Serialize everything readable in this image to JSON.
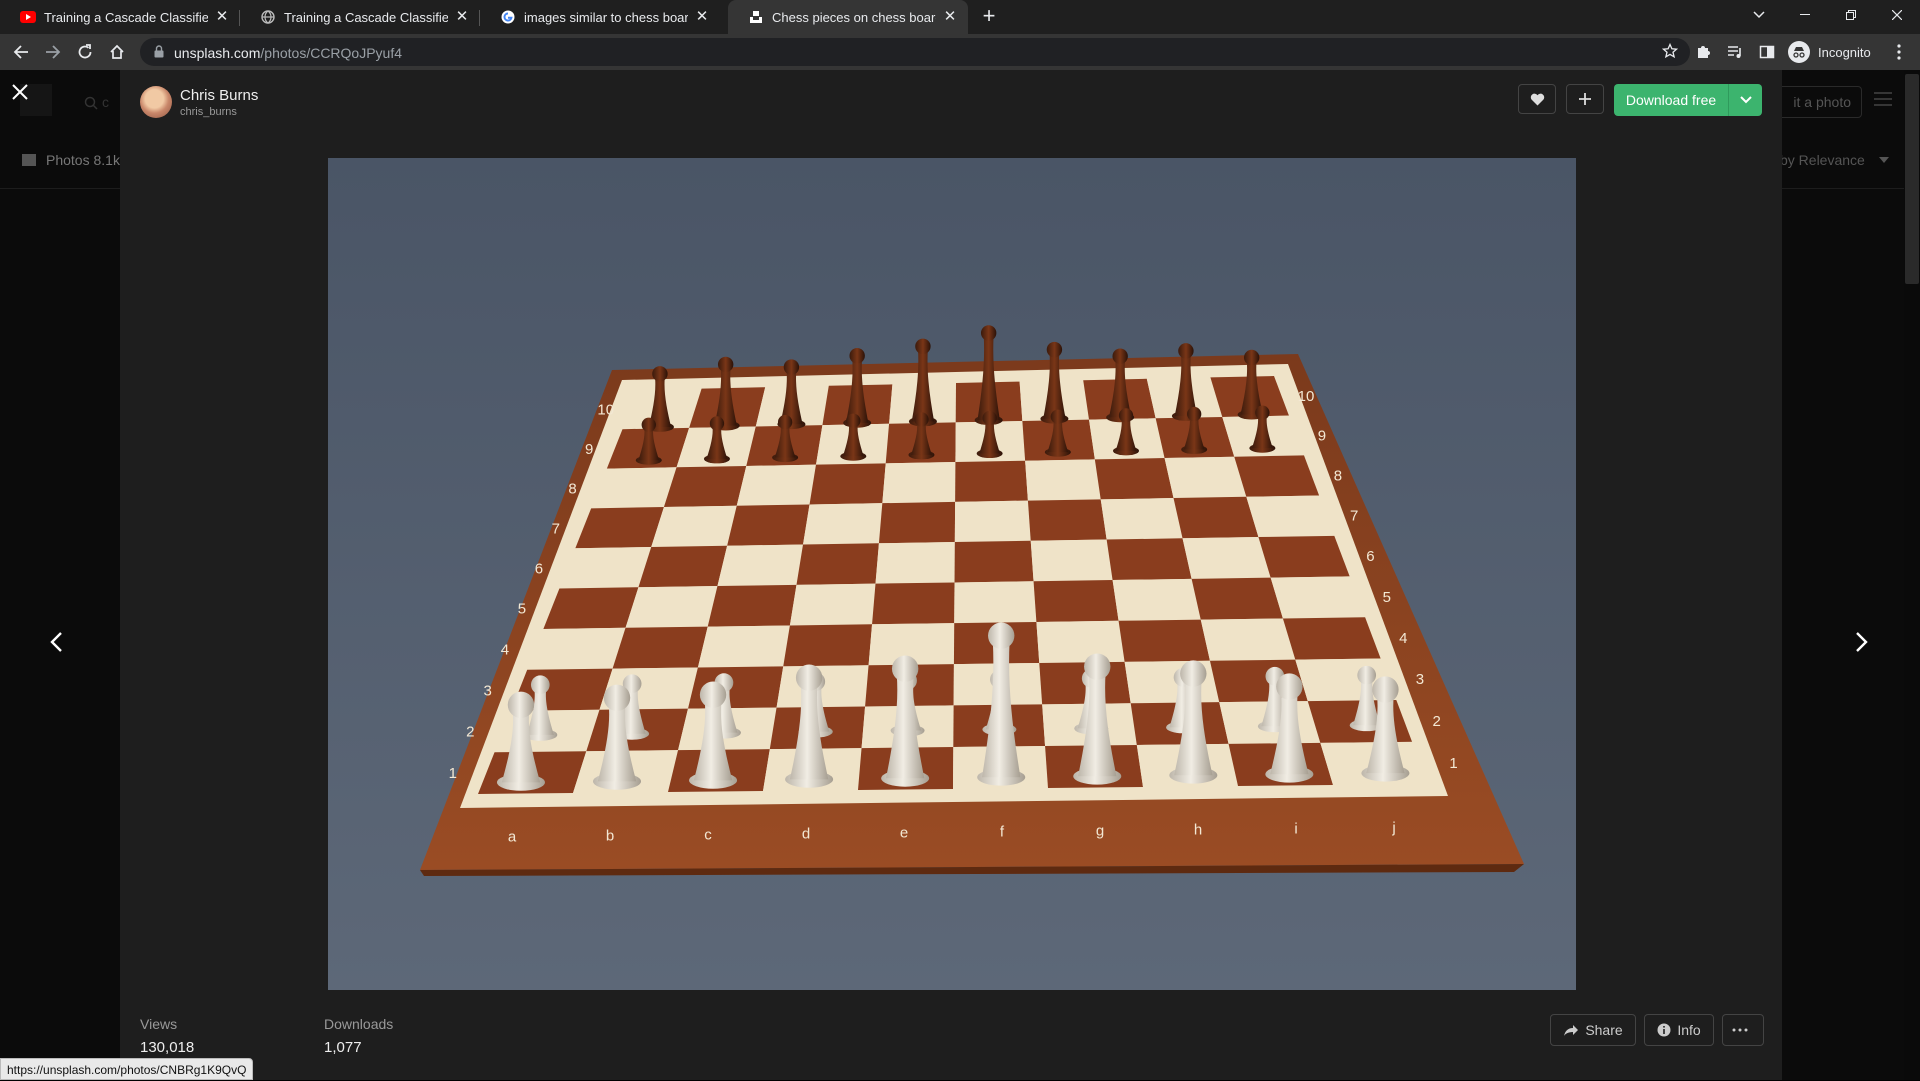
{
  "browser": {
    "tabs": [
      {
        "title": "Training a Cascade Classifier - Op",
        "favicon": "youtube-icon",
        "active": false
      },
      {
        "title": "Training a Cascade Classifier - Le",
        "favicon": "globe-icon",
        "active": false
      },
      {
        "title": "images similar to chess board - G",
        "favicon": "google-icon",
        "active": false
      },
      {
        "title": "Chess pieces on chess board pho",
        "favicon": "unsplash-icon",
        "active": true
      }
    ],
    "url_host": "unsplash.com",
    "url_path": "/photos/CCRQoJPyuf4",
    "profile_label": "Incognito"
  },
  "background_page": {
    "search_placeholder": "c",
    "submit_label": "it a photo",
    "photos_tab": "Photos 8.1k",
    "sort_label": "by Relevance"
  },
  "modal": {
    "author": {
      "name": "Chris Burns",
      "handle": "chris_burns"
    },
    "download_label": "Download free",
    "stats": [
      {
        "label": "Views",
        "value": "130,018"
      },
      {
        "label": "Downloads",
        "value": "1,077"
      }
    ],
    "share_label": "Share",
    "info_label": "Info"
  },
  "photo": {
    "rank_labels": [
      "1",
      "2",
      "3",
      "4",
      "5",
      "6",
      "7",
      "8",
      "9",
      "10"
    ],
    "file_labels": [
      "a",
      "b",
      "c",
      "d",
      "e",
      "f",
      "g",
      "h",
      "i",
      "j"
    ]
  },
  "status_url": "https://unsplash.com/photos/CNBRg1K9QvQ",
  "colors": {
    "accent": "#3cb46e",
    "board_dark": "#8a3d1e",
    "board_light": "#efe3c8"
  }
}
